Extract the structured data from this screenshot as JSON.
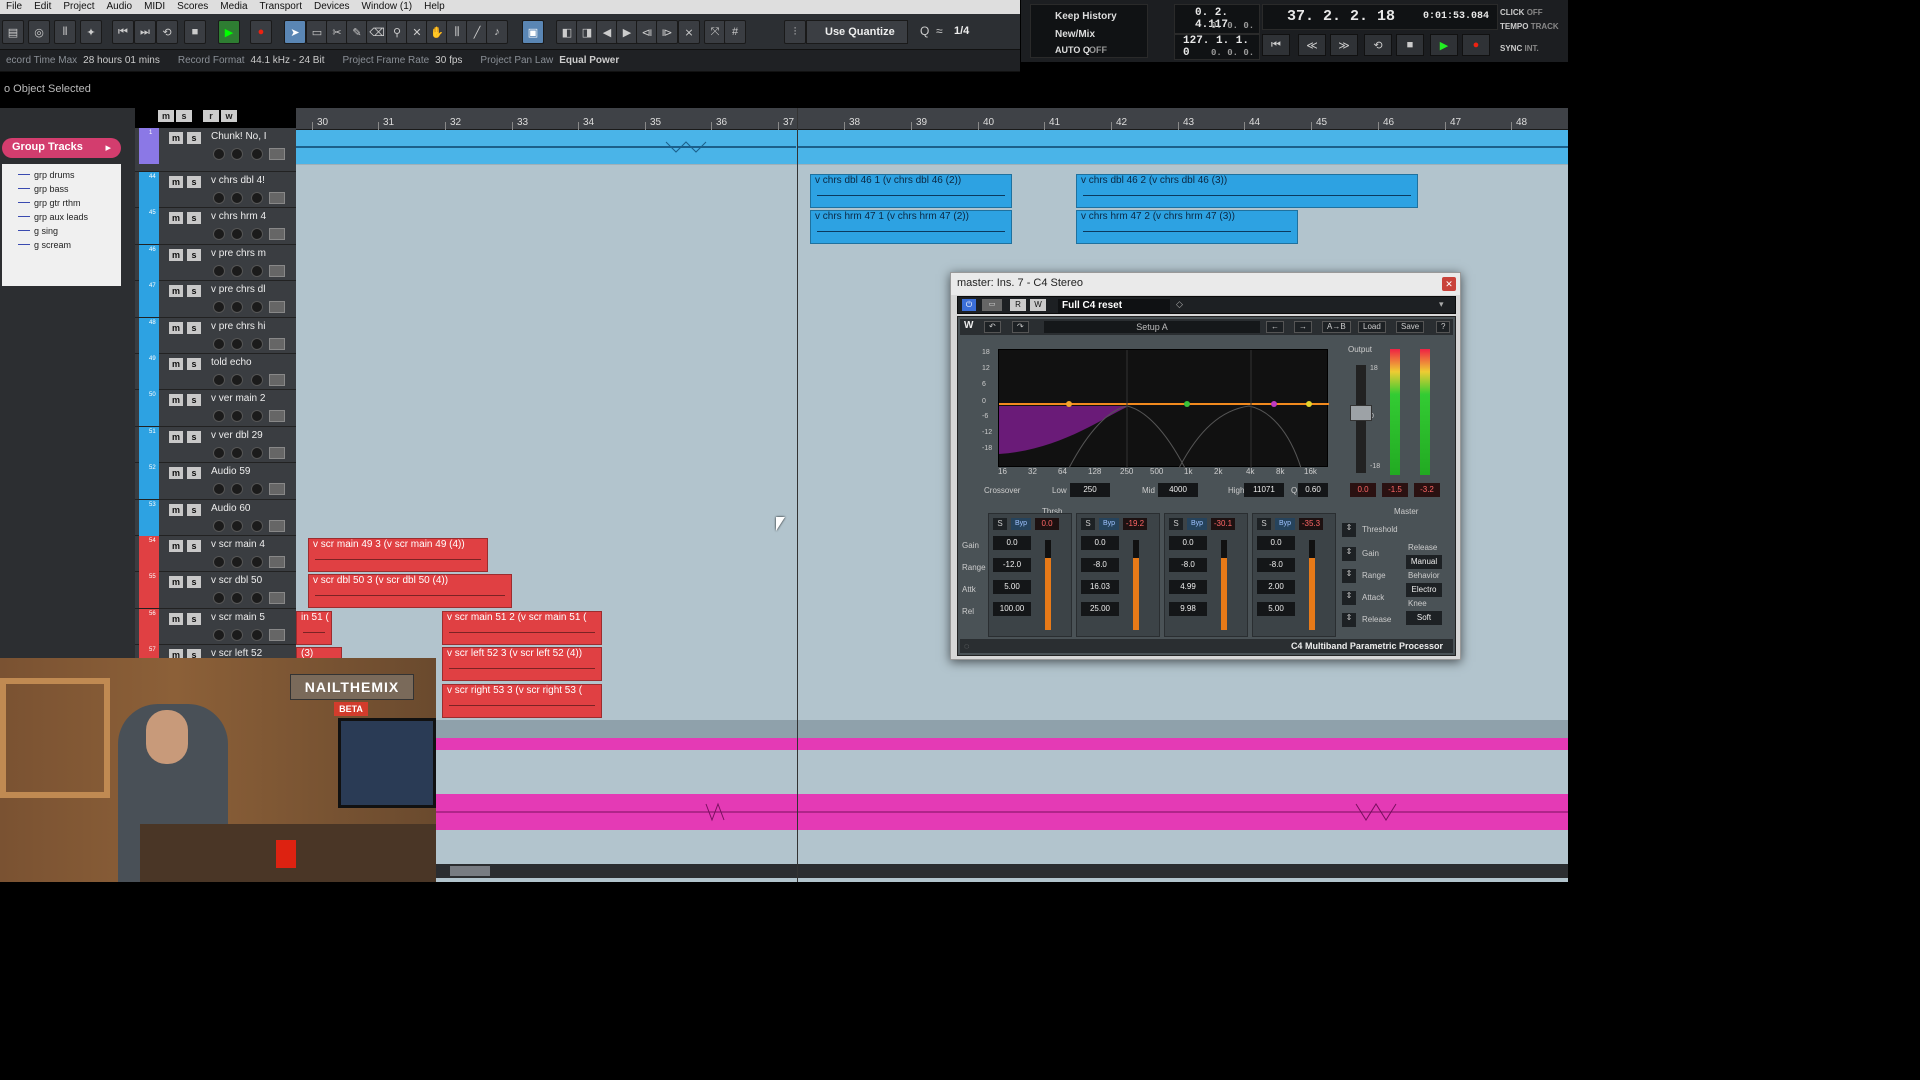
{
  "menu": [
    "File",
    "Edit",
    "Project",
    "Audio",
    "MIDI",
    "Scores",
    "Media",
    "Transport",
    "Devices",
    "Window (1)",
    "Help"
  ],
  "toolbar": {
    "quantize_label": "Use Quantize",
    "quantize_value": "1/4"
  },
  "transport": {
    "history_top": "Keep History",
    "history_mid": "New/Mix",
    "auto_q": "AUTO Q",
    "auto_q_state": "OFF",
    "left_locator": "0. 2. 4.117",
    "left_sub": "0.  0.  0.",
    "right_locator": "127. 1. 1.  0",
    "right_sub": "0.  0.  0.",
    "position_bars": "37. 2. 2. 18",
    "position_time": "0:01:53.084",
    "click": "CLICK",
    "click_state": "OFF",
    "tempo": "TEMPO",
    "track": "TRACK",
    "sync": "SYNC",
    "int": "INT."
  },
  "infoline": [
    {
      "label": "ecord Time Max",
      "value": "28 hours 01 mins"
    },
    {
      "label": "Record Format",
      "value": "44.1 kHz - 24 Bit"
    },
    {
      "label": "Project Frame Rate",
      "value": "30 fps"
    },
    {
      "label": "Project Pan Law",
      "value": "Equal Power"
    }
  ],
  "object_selected": "o Object Selected",
  "inspector": {
    "group_tracks": "Group Tracks",
    "groups": [
      "grp drums",
      "grp bass",
      "grp gtr rthm",
      "grp aux leads",
      "g sing",
      "g scream"
    ]
  },
  "ruler": {
    "bars": [
      "30",
      "31",
      "32",
      "33",
      "34",
      "35",
      "36",
      "37",
      "38",
      "39",
      "40",
      "41",
      "42",
      "43",
      "44",
      "45",
      "46",
      "47",
      "48"
    ]
  },
  "tracks": [
    {
      "num": "1",
      "name": "Chunk! No, I",
      "color": "#8b78e6"
    },
    {
      "num": "44",
      "name": "v chrs dbl 4!",
      "color": "#2da2e2"
    },
    {
      "num": "45",
      "name": "v chrs hrm 4",
      "color": "#2da2e2"
    },
    {
      "num": "46",
      "name": "v pre chrs m",
      "color": "#2da2e2"
    },
    {
      "num": "47",
      "name": "v pre chrs dl",
      "color": "#2da2e2"
    },
    {
      "num": "48",
      "name": "v pre chrs hi",
      "color": "#2da2e2"
    },
    {
      "num": "49",
      "name": "told echo",
      "color": "#2da2e2"
    },
    {
      "num": "50",
      "name": "v ver main 2",
      "color": "#2da2e2"
    },
    {
      "num": "51",
      "name": "v ver dbl 29",
      "color": "#2da2e2"
    },
    {
      "num": "52",
      "name": "Audio 59",
      "color": "#2da2e2"
    },
    {
      "num": "53",
      "name": "Audio 60",
      "color": "#2da2e2"
    },
    {
      "num": "54",
      "name": "v scr main 4",
      "color": "#e04043"
    },
    {
      "num": "55",
      "name": "v scr dbl 50",
      "color": "#e04043"
    },
    {
      "num": "56",
      "name": "v scr main 5",
      "color": "#e04043"
    },
    {
      "num": "57",
      "name": "v scr left 52",
      "color": "#e04043"
    }
  ],
  "clips": [
    {
      "label": "v chrs dbl 46 1 (v chrs dbl 46 (2))",
      "color": "blue"
    },
    {
      "label": "v chrs dbl 46 2 (v chrs dbl 46 (3))",
      "color": "blue"
    },
    {
      "label": "v chrs hrm 47 1 (v chrs hrm 47 (2))",
      "color": "blue"
    },
    {
      "label": "v chrs hrm 47 2 (v chrs hrm 47 (3))",
      "color": "blue"
    },
    {
      "label": "v scr main 49 3 (v scr main 49 (4))",
      "color": "red"
    },
    {
      "label": "v scr dbl 50 3 (v scr dbl 50 (4))",
      "color": "red"
    },
    {
      "label": "in 51 (",
      "color": "red"
    },
    {
      "label": "v scr main 51 2 (v scr main 51 (",
      "color": "red"
    },
    {
      "label": "(3)",
      "color": "red"
    },
    {
      "label": "v scr left 52 3 (v scr left 52 (4))",
      "color": "red"
    },
    {
      "label": "v scr right 53 3 (v scr right 53 (",
      "color": "red"
    }
  ],
  "plugin": {
    "title": "master: Ins. 7 - C4 Stereo",
    "preset": "Full C4 reset",
    "setup": "Setup A",
    "btn_ab": "A→B",
    "btn_load": "Load",
    "btn_save": "Save",
    "output_label": "Output",
    "db_scale": [
      "18",
      "12",
      "6",
      "0",
      "-6",
      "-12",
      "-18"
    ],
    "freq_scale": [
      "16",
      "32",
      "64",
      "128",
      "250",
      "500",
      "1k",
      "2k",
      "4k",
      "8k",
      "16k"
    ],
    "out_scale": [
      "18",
      "0",
      "-18"
    ],
    "crossover_label": "Crossover",
    "low_label": "Low",
    "low_value": "250",
    "mid_label": "Mid",
    "mid_value": "4000",
    "high_label": "High",
    "high_value": "11071",
    "q_label": "Q",
    "q_value": "0.60",
    "out_readouts": [
      "0.0",
      "-1.5",
      "-3.2"
    ],
    "thrsh_label": "Thrsh",
    "row_labels": [
      "Gain",
      "Range",
      "Attk",
      "Rel"
    ],
    "bands": [
      {
        "thresh": "0.0",
        "gain": "0.0",
        "range": "-12.0",
        "attack": "5.00",
        "release": "100.00"
      },
      {
        "thresh": "-19.2",
        "gain": "0.0",
        "range": "-8.0",
        "attack": "16.03",
        "release": "25.00"
      },
      {
        "thresh": "-30.1",
        "gain": "0.0",
        "range": "-8.0",
        "attack": "4.99",
        "release": "9.98"
      },
      {
        "thresh": "-35.3",
        "gain": "0.0",
        "range": "-8.0",
        "attack": "2.00",
        "release": "5.00"
      }
    ],
    "master": {
      "label": "Master",
      "threshold": "Threshold",
      "gain": "Gain",
      "release_label": "Release",
      "release_value": "Manual",
      "range": "Range",
      "behavior_label": "Behavior",
      "behavior_value": "Electro",
      "attack": "Attack",
      "knee_label": "Knee",
      "knee_value": "Soft",
      "release2": "Release"
    },
    "footer": "C4 Multiband Parametric Processor"
  },
  "webcam": {
    "sign": "NAILTHEMIX",
    "beta": "BETA"
  }
}
